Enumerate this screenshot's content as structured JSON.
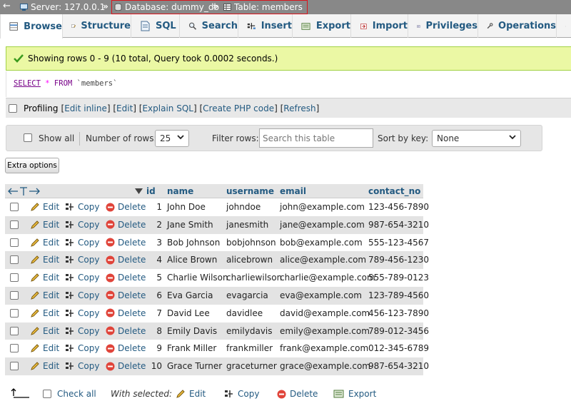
{
  "breadcrumb": {
    "back_glyph": "←",
    "server": "Server: 127.0.0.1",
    "database": "Database: dummy_db",
    "table": "Table: members",
    "separator": "»"
  },
  "tabs": [
    {
      "label": "Browse",
      "icon": "browse-icon",
      "active": true
    },
    {
      "label": "Structure",
      "icon": "structure-icon"
    },
    {
      "label": "SQL",
      "icon": "sql-icon"
    },
    {
      "label": "Search",
      "icon": "search-icon"
    },
    {
      "label": "Insert",
      "icon": "insert-icon"
    },
    {
      "label": "Export",
      "icon": "export-icon"
    },
    {
      "label": "Import",
      "icon": "import-icon"
    },
    {
      "label": "Privileges",
      "icon": "privileges-icon"
    },
    {
      "label": "Operations",
      "icon": "operations-icon"
    }
  ],
  "message": {
    "text": "Showing rows 0 - 9 (10 total, Query took 0.0002 seconds.)"
  },
  "query": {
    "select": "SELECT",
    "star": "*",
    "from": "FROM",
    "table": "`members`"
  },
  "profiling": {
    "label": "Profiling",
    "open": "[",
    "close": "]",
    "sep": "] [",
    "links": [
      "Edit inline",
      "Edit",
      "Explain SQL",
      "Create PHP code",
      "Refresh"
    ]
  },
  "navigation": {
    "show_all": "Show all",
    "rows_label": "Number of rows:",
    "rows_value": "25",
    "filter_label": "Filter rows:",
    "filter_placeholder": "Search this table",
    "sort_label": "Sort by key:",
    "sort_value": "None"
  },
  "extra_options": "Extra options",
  "table": {
    "headers": {
      "id": "id",
      "name": "name",
      "username": "username",
      "email": "email",
      "contact_no": "contact_no"
    },
    "actions": {
      "edit": "Edit",
      "copy": "Copy",
      "delete": "Delete"
    },
    "rows": [
      {
        "id": "1",
        "name": "John Doe",
        "username": "johndoe",
        "email": "john@example.com",
        "contact_no": "123-456-7890"
      },
      {
        "id": "2",
        "name": "Jane Smith",
        "username": "janesmith",
        "email": "jane@example.com",
        "contact_no": "987-654-3210"
      },
      {
        "id": "3",
        "name": "Bob Johnson",
        "username": "bobjohnson",
        "email": "bob@example.com",
        "contact_no": "555-123-4567"
      },
      {
        "id": "4",
        "name": "Alice Brown",
        "username": "alicebrown",
        "email": "alice@example.com",
        "contact_no": "789-456-1230"
      },
      {
        "id": "5",
        "name": "Charlie Wilson",
        "username": "charliewilson",
        "email": "charlie@example.com",
        "contact_no": "555-789-0123"
      },
      {
        "id": "6",
        "name": "Eva Garcia",
        "username": "evagarcia",
        "email": "eva@example.com",
        "contact_no": "123-789-4560"
      },
      {
        "id": "7",
        "name": "David Lee",
        "username": "davidlee",
        "email": "david@example.com",
        "contact_no": "456-123-7890"
      },
      {
        "id": "8",
        "name": "Emily Davis",
        "username": "emilydavis",
        "email": "emily@example.com",
        "contact_no": "789-012-3456"
      },
      {
        "id": "9",
        "name": "Frank Miller",
        "username": "frankmiller",
        "email": "frank@example.com",
        "contact_no": "012-345-6789"
      },
      {
        "id": "10",
        "name": "Grace Turner",
        "username": "graceturner",
        "email": "grace@example.com",
        "contact_no": "987-654-3210"
      }
    ]
  },
  "bottom": {
    "check_all": "Check all",
    "with_selected": "With selected:",
    "edit": "Edit",
    "copy": "Copy",
    "delete": "Delete",
    "export": "Export"
  },
  "colors": {
    "link": "#235a81",
    "success_bg": "#ebf8a4",
    "breadcrumb_bg": "#888888",
    "highlight_border": "#d9141c",
    "row_alt": "#e3e3e3"
  }
}
